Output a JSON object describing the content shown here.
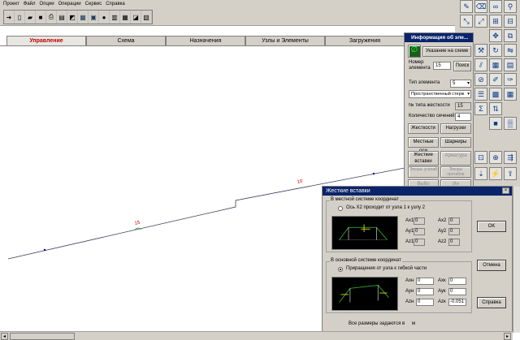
{
  "menu": [
    "Проект",
    "Файл",
    "Опции",
    "Операции",
    "Сервис",
    "Справка"
  ],
  "tabs": [
    {
      "label": "Управление",
      "active": true
    },
    {
      "label": "Схема",
      "active": false
    },
    {
      "label": "Назначения",
      "active": false
    },
    {
      "label": "Узлы и Элементы",
      "active": false
    },
    {
      "label": "Загружения",
      "active": false
    }
  ],
  "canvas": {
    "element_label_left": "15",
    "element_label_right": "10",
    "colors": {
      "line": "#3a3a5a",
      "label": "#c00000",
      "node": "#0000aa",
      "selected": "#2aa02a"
    }
  },
  "info_window": {
    "title": "Информация об эле...",
    "show_on_scheme": "Указание на схеме",
    "element_number_label": "Номер элемента",
    "element_number": "15",
    "search": "Поиск",
    "element_type_label": "Тип элемента",
    "element_type": "5",
    "element_type_name": "Пространственный стерж",
    "stiffness_type_label": "№ типа жесткости",
    "stiffness_type": "15",
    "sections_label": "Количество сечений",
    "sections": "4",
    "btn_stiffness": "Жесткости",
    "btn_loads": "Нагрузки",
    "btn_local_axes": "Местные оси",
    "btn_hinges": "Шарниры",
    "btn_rigid_inserts": "Жесткие вставки",
    "btn_reinforcement": "Арматура",
    "btn_stress_node": "Эпюры усилий",
    "btn_stress_span": "Эпюры прогибов",
    "btn_more1": "Выбо",
    "btn_more2": "Ин"
  },
  "rigid_dialog": {
    "title": "Жесткие вставки",
    "local_group": "В местной системе координат",
    "local_option": "Ось X2 проходит от узла 1 к узлу 2",
    "local_fields": {
      "ax1": "Ax1",
      "ay1": "Ay1",
      "az1": "Az1",
      "ax2": "Ax2",
      "ay2": "Ay2",
      "az2": "Az2",
      "v1": "0",
      "v2": "0",
      "v3": "0",
      "v4": "0",
      "v5": "0",
      "v6": "0"
    },
    "global_group": "В основной системе координат",
    "global_option": "Приращения от узла к гибкой части",
    "global_fields": {
      "axn": "Axн",
      "ayn": "Ayн",
      "azn": "Azн",
      "axk": "Axк",
      "ayk": "Ayк",
      "azk": "Azк",
      "axn_v": "0",
      "ayn_v": "0",
      "azn_v": "0",
      "axk_v": "0",
      "ayk_v": "0",
      "azk_v": "-0.051"
    },
    "ok": "OK",
    "cancel": "Отмена",
    "help": "Справка",
    "units_note": "Все размеры задаются в",
    "units": "м"
  }
}
